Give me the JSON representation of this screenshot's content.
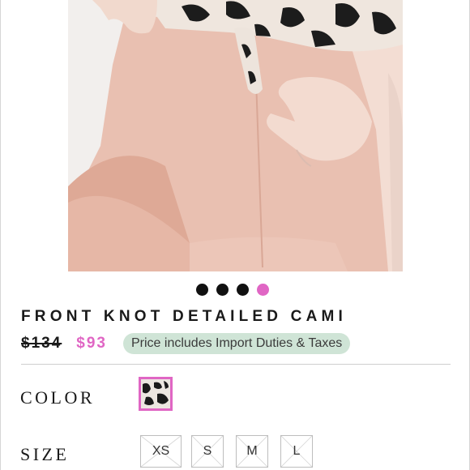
{
  "product": {
    "title": "FRONT KNOT DETAILED CAMI",
    "original_price": "$134",
    "sale_price": "$93",
    "duties_badge": "Price includes Import Duties & Taxes"
  },
  "carousel": {
    "total": 4,
    "active_index": 3
  },
  "color_section": {
    "label": "COLOR",
    "swatch_icon": "cow-print-swatch"
  },
  "size_section": {
    "label": "SIZE",
    "options": [
      "XS",
      "S",
      "M",
      "L"
    ]
  },
  "colors": {
    "accent": "#e066c4",
    "badge_bg": "#cfe4d6",
    "shorts": "#e7bcae"
  }
}
